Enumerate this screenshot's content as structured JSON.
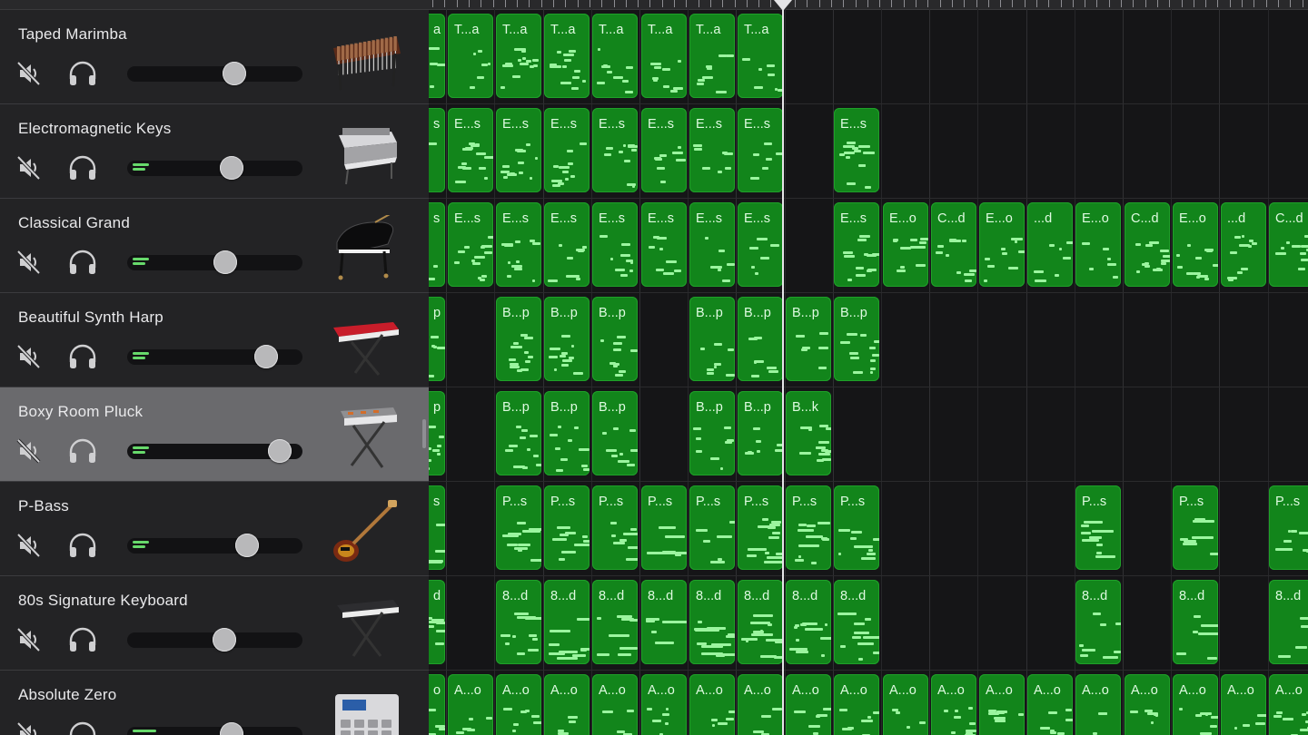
{
  "tracks": [
    {
      "name": "Taped Marimba",
      "meter_bars": 0,
      "volume": 0.63,
      "instrument_icon": "marimba-icon",
      "selected": false
    },
    {
      "name": "Electromagnetic Keys",
      "meter_bars": 2,
      "volume": 0.61,
      "instrument_icon": "electric-piano-icon",
      "selected": false
    },
    {
      "name": "Classical Grand",
      "meter_bars": 2,
      "volume": 0.57,
      "instrument_icon": "grand-piano-icon",
      "selected": false
    },
    {
      "name": "Beautiful Synth Harp",
      "meter_bars": 2,
      "volume": 0.84,
      "instrument_icon": "synth-keyboard-icon",
      "selected": false
    },
    {
      "name": "Boxy Room Pluck",
      "meter_bars": 2,
      "volume": 0.93,
      "instrument_icon": "synth-keyboard-stand-icon",
      "selected": true
    },
    {
      "name": "P-Bass",
      "meter_bars": 2,
      "volume": 0.71,
      "instrument_icon": "bass-guitar-icon",
      "selected": false
    },
    {
      "name": "80s Signature Keyboard",
      "meter_bars": 0,
      "volume": 0.56,
      "instrument_icon": "keyboard-stand-icon",
      "selected": false
    },
    {
      "name": "Absolute Zero",
      "meter_bars": 1,
      "volume": 0.61,
      "instrument_icon": "drum-machine-icon",
      "selected": false
    }
  ],
  "lanes": [
    {
      "regions": [
        {
          "start": 0,
          "label": "a"
        },
        {
          "start": 1,
          "label": "T...a"
        },
        {
          "start": 2,
          "label": "T...a"
        },
        {
          "start": 3,
          "label": "T...a"
        },
        {
          "start": 4,
          "label": "T...a"
        },
        {
          "start": 5,
          "label": "T...a"
        },
        {
          "start": 6,
          "label": "T...a"
        },
        {
          "start": 7,
          "label": "T...a"
        }
      ]
    },
    {
      "regions": [
        {
          "start": 0,
          "label": "s"
        },
        {
          "start": 1,
          "label": "E...s"
        },
        {
          "start": 2,
          "label": "E...s"
        },
        {
          "start": 3,
          "label": "E...s"
        },
        {
          "start": 4,
          "label": "E...s"
        },
        {
          "start": 5,
          "label": "E...s"
        },
        {
          "start": 6,
          "label": "E...s"
        },
        {
          "start": 7,
          "label": "E...s"
        },
        {
          "start": 9,
          "label": "E...s"
        }
      ]
    },
    {
      "regions": [
        {
          "start": 0,
          "label": "s"
        },
        {
          "start": 1,
          "label": "E...s"
        },
        {
          "start": 2,
          "label": "E...s"
        },
        {
          "start": 3,
          "label": "E...s"
        },
        {
          "start": 4,
          "label": "E...s"
        },
        {
          "start": 5,
          "label": "E...s"
        },
        {
          "start": 6,
          "label": "E...s"
        },
        {
          "start": 7,
          "label": "E...s"
        },
        {
          "start": 9,
          "label": "E...s"
        },
        {
          "start": 10,
          "label": "E...o"
        },
        {
          "start": 11,
          "label": "C...d"
        },
        {
          "start": 12,
          "label": "E...o"
        },
        {
          "start": 13,
          "label": "...d"
        },
        {
          "start": 14,
          "label": "E...o"
        },
        {
          "start": 15,
          "label": "C...d"
        },
        {
          "start": 16,
          "label": "E...o"
        },
        {
          "start": 17,
          "label": "...d"
        },
        {
          "start": 18,
          "label": "C...d"
        }
      ]
    },
    {
      "regions": [
        {
          "start": 0,
          "label": "p"
        },
        {
          "start": 2,
          "label": "B...p"
        },
        {
          "start": 3,
          "label": "B...p"
        },
        {
          "start": 4,
          "label": "B...p"
        },
        {
          "start": 6,
          "label": "B...p"
        },
        {
          "start": 7,
          "label": "B...p"
        },
        {
          "start": 8,
          "label": "B...p"
        },
        {
          "start": 9,
          "label": "B...p"
        }
      ]
    },
    {
      "regions": [
        {
          "start": 0,
          "label": "p"
        },
        {
          "start": 2,
          "label": "B...p"
        },
        {
          "start": 3,
          "label": "B...p"
        },
        {
          "start": 4,
          "label": "B...p"
        },
        {
          "start": 6,
          "label": "B...p"
        },
        {
          "start": 7,
          "label": "B...p"
        },
        {
          "start": 8,
          "label": "B...k"
        }
      ]
    },
    {
      "regions": [
        {
          "start": 0,
          "label": "s"
        },
        {
          "start": 2,
          "label": "P...s"
        },
        {
          "start": 3,
          "label": "P...s"
        },
        {
          "start": 4,
          "label": "P...s"
        },
        {
          "start": 5,
          "label": "P...s"
        },
        {
          "start": 6,
          "label": "P...s"
        },
        {
          "start": 7,
          "label": "P...s"
        },
        {
          "start": 8,
          "label": "P...s"
        },
        {
          "start": 9,
          "label": "P...s"
        },
        {
          "start": 14,
          "label": "P...s"
        },
        {
          "start": 16,
          "label": "P...s"
        },
        {
          "start": 18,
          "label": "P...s"
        }
      ]
    },
    {
      "regions": [
        {
          "start": 0,
          "label": "d"
        },
        {
          "start": 2,
          "label": "8...d"
        },
        {
          "start": 3,
          "label": "8...d"
        },
        {
          "start": 4,
          "label": "8...d"
        },
        {
          "start": 5,
          "label": "8...d"
        },
        {
          "start": 6,
          "label": "8...d"
        },
        {
          "start": 7,
          "label": "8...d"
        },
        {
          "start": 8,
          "label": "8...d"
        },
        {
          "start": 9,
          "label": "8...d"
        },
        {
          "start": 14,
          "label": "8...d"
        },
        {
          "start": 16,
          "label": "8...d"
        },
        {
          "start": 18,
          "label": "8...d"
        }
      ]
    },
    {
      "regions": [
        {
          "start": 0,
          "label": "o"
        },
        {
          "start": 1,
          "label": "A...o"
        },
        {
          "start": 2,
          "label": "A...o"
        },
        {
          "start": 3,
          "label": "A...o"
        },
        {
          "start": 4,
          "label": "A...o"
        },
        {
          "start": 5,
          "label": "A...o"
        },
        {
          "start": 6,
          "label": "A...o"
        },
        {
          "start": 7,
          "label": "A...o"
        },
        {
          "start": 8,
          "label": "A...o"
        },
        {
          "start": 9,
          "label": "A...o"
        },
        {
          "start": 10,
          "label": "A...o"
        },
        {
          "start": 11,
          "label": "A...o"
        },
        {
          "start": 12,
          "label": "A...o"
        },
        {
          "start": 13,
          "label": "A...o"
        },
        {
          "start": 14,
          "label": "A...o"
        },
        {
          "start": 15,
          "label": "A...o"
        },
        {
          "start": 16,
          "label": "A...o"
        },
        {
          "start": 17,
          "label": "A...o"
        },
        {
          "start": 18,
          "label": "A...o"
        }
      ]
    }
  ],
  "colors": {
    "region": "#12851b",
    "note": "#9bf59f",
    "selected_track": "#6a6a6d",
    "meter": "#67d96b"
  }
}
